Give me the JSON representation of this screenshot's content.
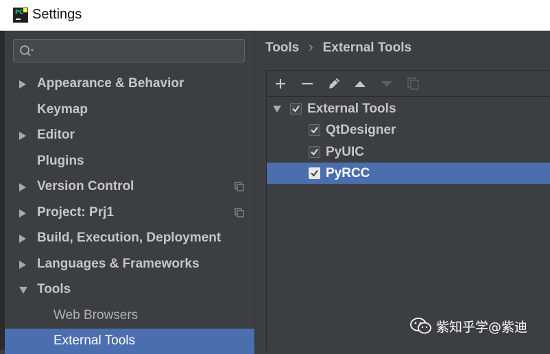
{
  "window": {
    "title": "Settings",
    "app_icon": "pycharm-icon"
  },
  "search": {
    "placeholder": "",
    "value": "",
    "icon": "search-icon"
  },
  "sidebar": {
    "items": [
      {
        "label": "Appearance & Behavior",
        "expandable": true,
        "expanded": false
      },
      {
        "label": "Keymap",
        "expandable": false
      },
      {
        "label": "Editor",
        "expandable": true,
        "expanded": false
      },
      {
        "label": "Plugins",
        "expandable": false
      },
      {
        "label": "Version Control",
        "expandable": true,
        "expanded": false,
        "project_icon": "copy-icon"
      },
      {
        "label": "Project: Prj1",
        "expandable": true,
        "expanded": false,
        "project_icon": "copy-icon"
      },
      {
        "label": "Build, Execution, Deployment",
        "expandable": true,
        "expanded": false
      },
      {
        "label": "Languages & Frameworks",
        "expandable": true,
        "expanded": false
      },
      {
        "label": "Tools",
        "expandable": true,
        "expanded": true
      },
      {
        "label": "Web Browsers",
        "child": true
      },
      {
        "label": "External Tools",
        "child": true,
        "selected": true
      }
    ]
  },
  "breadcrumb": {
    "parent": "Tools",
    "separator": "›",
    "current": "External Tools"
  },
  "toolbar": {
    "buttons": [
      "add-icon",
      "remove-icon",
      "edit-icon",
      "move-up-icon",
      "move-down-icon",
      "copy-icon"
    ]
  },
  "tree": {
    "group": {
      "label": "External Tools",
      "checked": true,
      "expanded": true
    },
    "items": [
      {
        "label": "QtDesigner",
        "checked": true
      },
      {
        "label": "PyUIC",
        "checked": true
      },
      {
        "label": "PyRCC",
        "checked": true,
        "selected": true
      }
    ]
  },
  "watermark": {
    "text": "紫知乎学@紫迪"
  },
  "colors": {
    "background": "#3c3f41",
    "selection": "#4b6eaf",
    "text": "#c6c6c6"
  }
}
